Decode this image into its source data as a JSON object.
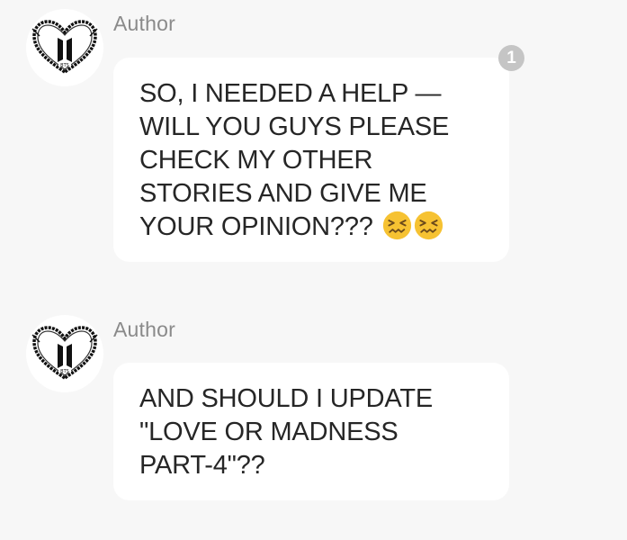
{
  "messages": [
    {
      "author": "Author",
      "avatar_icon": "bts-heart-logo",
      "text": "SO, I NEEDED A HELP —\nWILL YOU GUYS PLEASE\nCHECK MY OTHER\nSTORIES AND GIVE ME\nYOUR OPINION???",
      "emojis": [
        "confounded-face",
        "confounded-face"
      ],
      "comment_count": "1"
    },
    {
      "author": "Author",
      "avatar_icon": "bts-heart-logo",
      "text": "AND SHOULD I UPDATE\n\"LOVE OR MADNESS\nPART-4\"??"
    }
  ],
  "colors": {
    "background": "#f7f7f7",
    "bubble": "#ffffff",
    "author_name": "#8a8a8a",
    "text": "#262626",
    "badge": "#c5c5c5",
    "emoji": "#f6c232"
  }
}
